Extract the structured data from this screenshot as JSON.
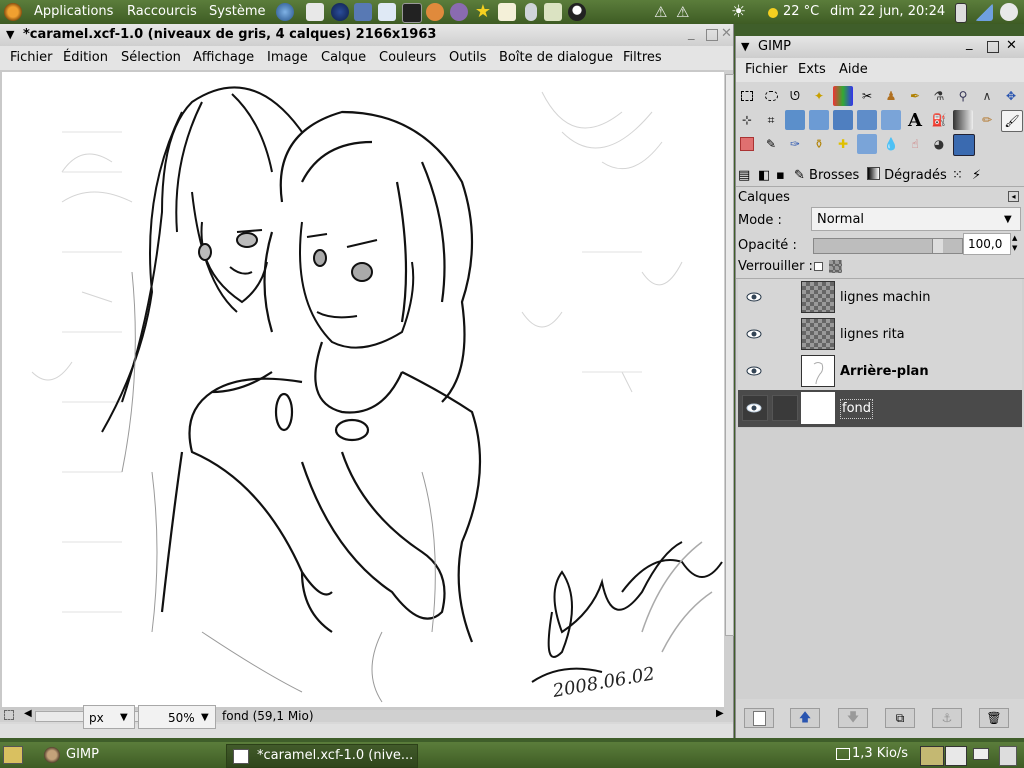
{
  "top_panel": {
    "menus": [
      "Applications",
      "Raccourcis",
      "Système"
    ],
    "weather": "22 °C",
    "clock": "dim 22 jun, 20:24"
  },
  "image_window": {
    "title": "*caramel.xcf-1.0 (niveaux de gris, 4 calques) 2166x1963",
    "menu": [
      "Fichier",
      "Édition",
      "Sélection",
      "Affichage",
      "Image",
      "Calque",
      "Couleurs",
      "Outils",
      "Boîte de dialogue",
      "Filtres"
    ],
    "signature_date": "2008.06.02",
    "status": {
      "unit": "px",
      "zoom": "50%",
      "info": "fond (59,1 Mio)"
    }
  },
  "dock": {
    "title": "GIMP",
    "menu": [
      "Fichier",
      "Exts",
      "Aide"
    ],
    "tabs": [
      "Brosses",
      "Dégradés"
    ],
    "layers_title": "Calques",
    "mode_label": "Mode :",
    "mode_value": "Normal",
    "opacity_label": "Opacité :",
    "opacity_value": "100,0",
    "lock_label": "Verrouiller :",
    "layers": [
      {
        "name": "lignes machin"
      },
      {
        "name": "lignes rita"
      },
      {
        "name": "Arrière-plan"
      },
      {
        "name": "fond"
      }
    ]
  },
  "bottom_panel": {
    "tasks": [
      "GIMP",
      "*caramel.xcf-1.0 (nive..."
    ],
    "net_speed": "1,3 Kio/s"
  },
  "colors": {
    "panel": "#4a6b2e",
    "selected_layer": "#4a4a4a"
  }
}
